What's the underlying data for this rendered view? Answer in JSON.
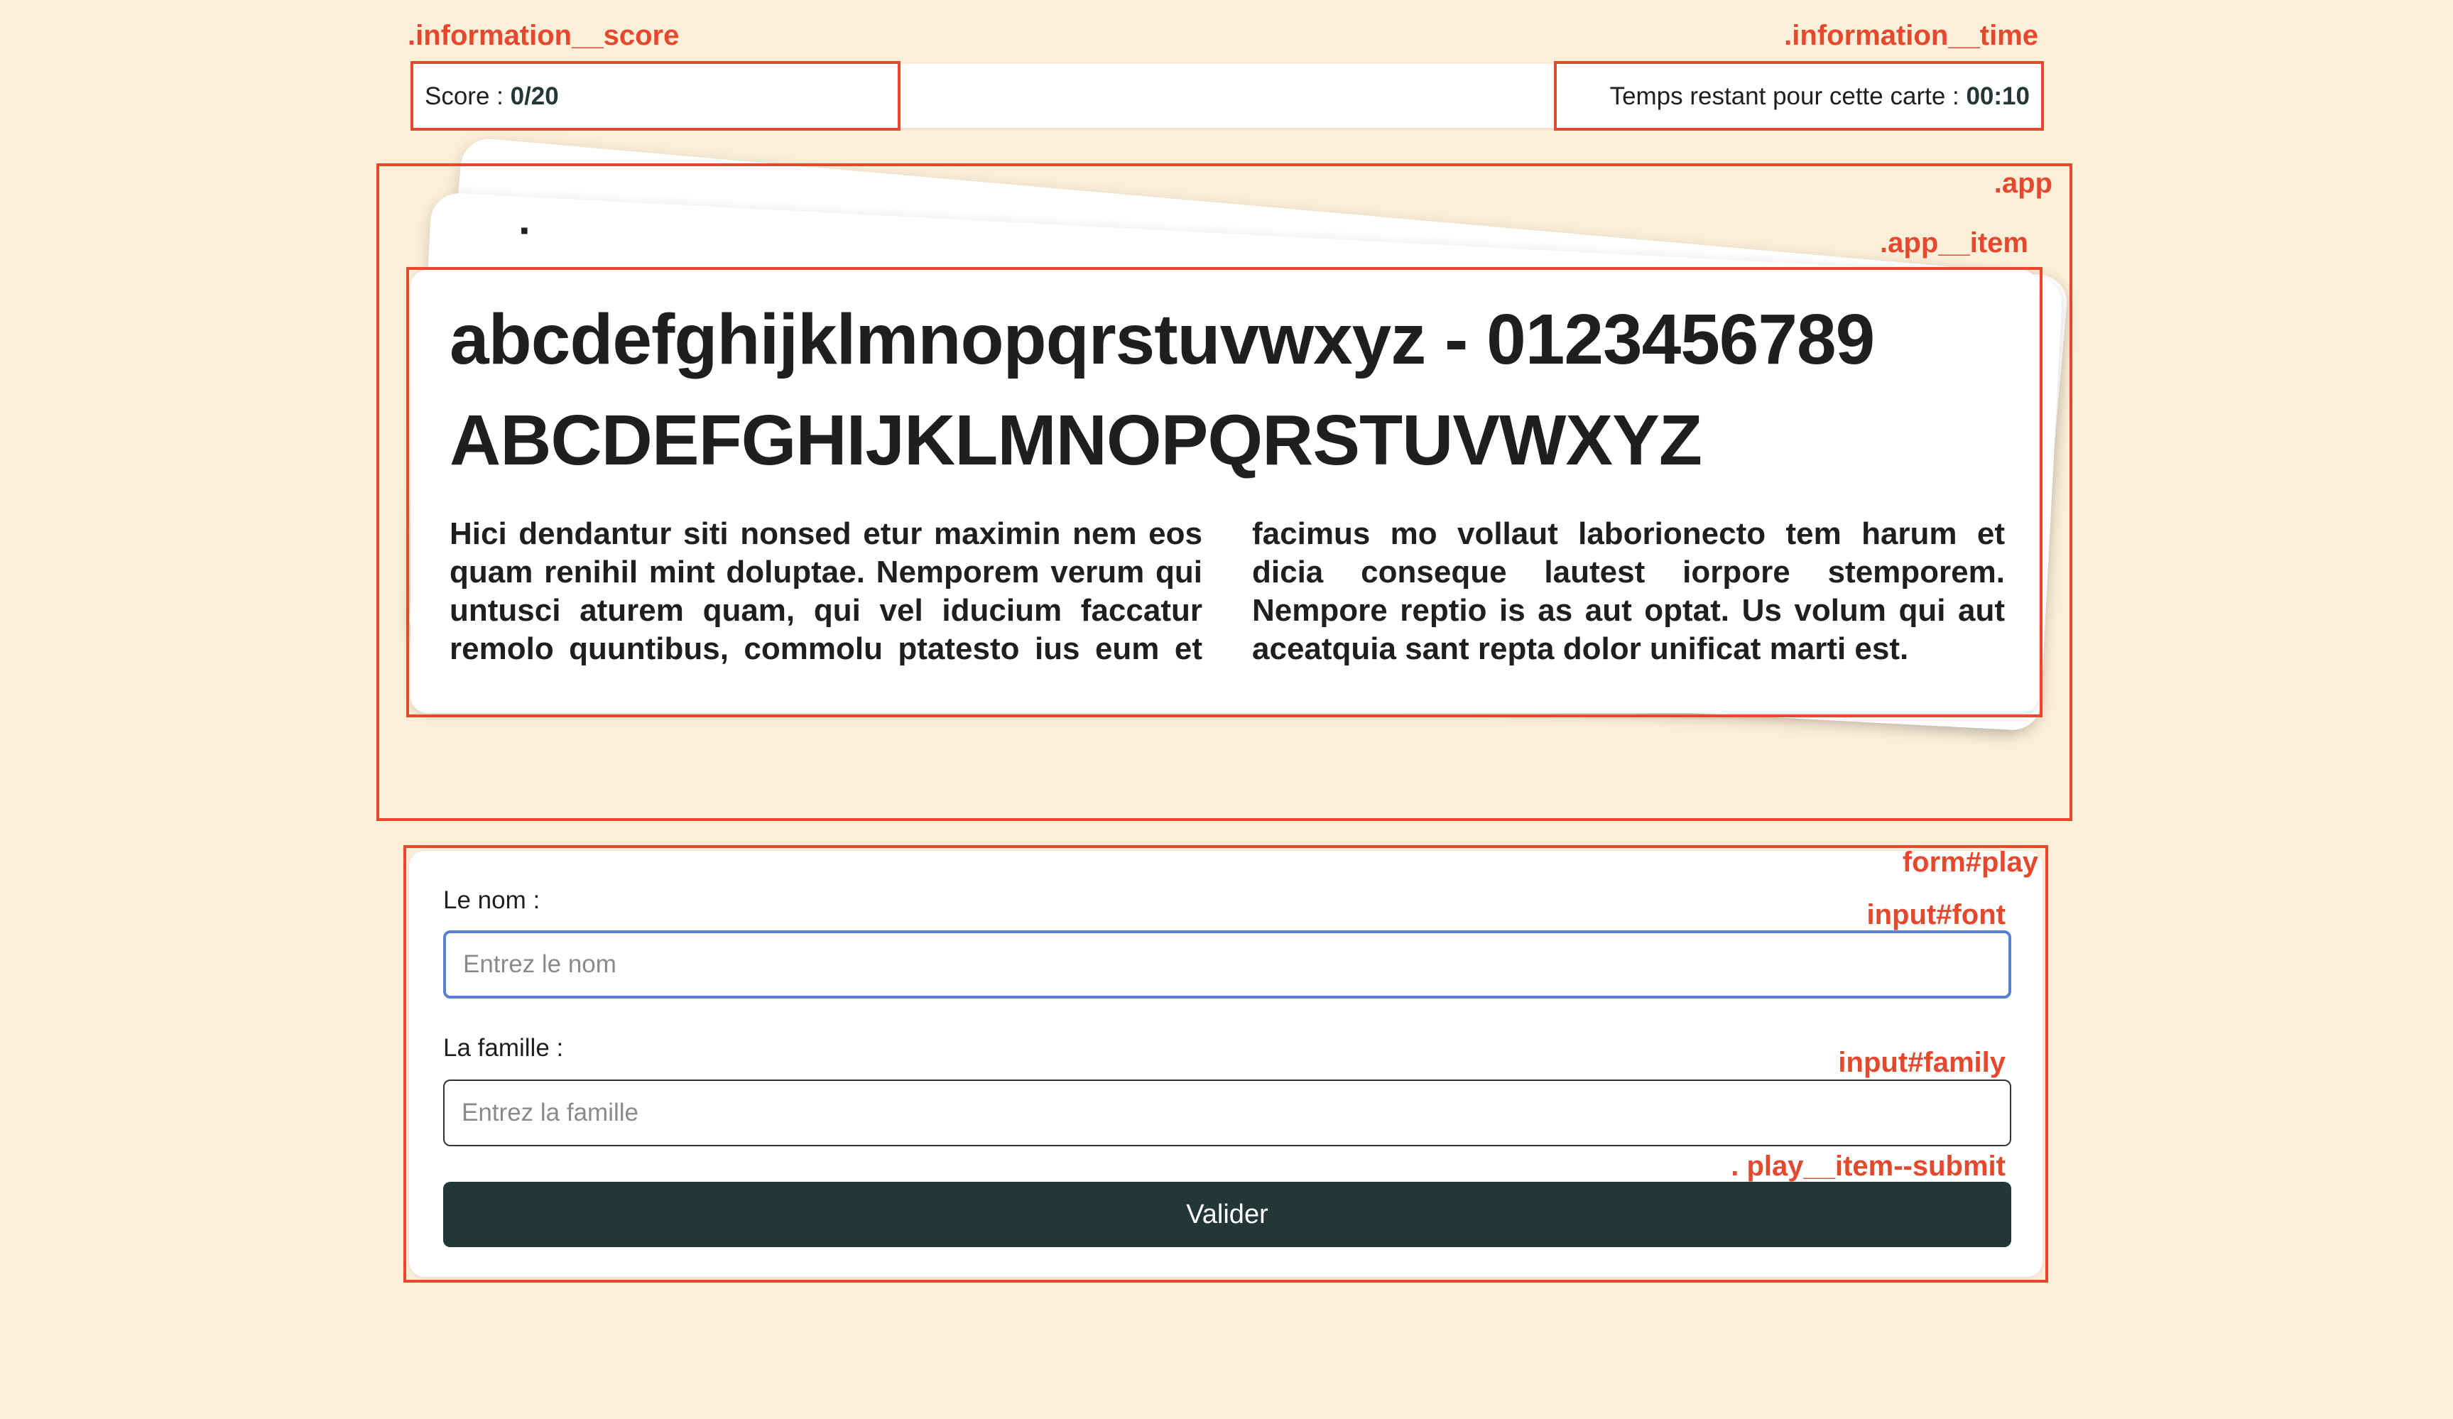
{
  "annotations": {
    "information_score": ".information__score",
    "information_time": ".information__time",
    "app": ".app",
    "app_item": ".app__item",
    "form_play": "form#play",
    "input_font": "input#font",
    "input_family": "input#family",
    "play_item_submit": ". play__item--submit",
    "color": "#e5482c"
  },
  "information": {
    "score_label": "Score : ",
    "score_value": "0/20",
    "time_label": "Temps restant pour cette carte : ",
    "time_value": "00:10"
  },
  "card": {
    "back_glyph": "·",
    "lowercase_line": "abcdefghijklmnopqrstuvwxyz - 0123456789",
    "uppercase_line": "ABCDEFGHIJKLMNOPQRSTUVWXYZ",
    "paragraph": "Hici dendantur siti nonsed etur maximin nem eos quam renihil mint doluptae. Nemporem verum qui untusci aturem quam, qui vel iducium faccatur remolo quuntibus, commolu ptatesto ius eum et facimus mo vollaut laborionecto tem harum et dicia conseque lautest iorpore stemporem. Nempore reptio is as aut optat. Us volum qui aut aceatquia sant repta dolor unificat marti est."
  },
  "form": {
    "font_label": "Le nom  :",
    "font_placeholder": "Entrez le nom",
    "font_value": "",
    "family_label": "La famille  :",
    "family_placeholder": "Entrez la famille",
    "family_value": "",
    "submit_label": "Valider"
  },
  "colors": {
    "background": "#fbefd9",
    "button": "#233736",
    "focus_border": "#5b7fd0"
  }
}
